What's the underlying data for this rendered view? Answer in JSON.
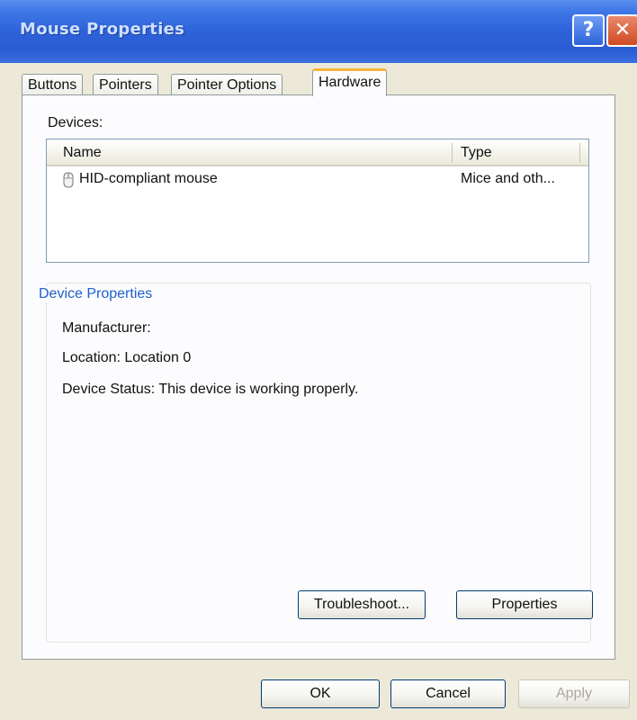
{
  "window": {
    "title": "Mouse Properties",
    "help_glyph": "?",
    "close_glyph": "✕"
  },
  "tabs": [
    {
      "label": "Buttons",
      "active": false
    },
    {
      "label": "Pointers",
      "active": false
    },
    {
      "label": "Pointer Options",
      "active": false
    },
    {
      "label": "Hardware",
      "active": true
    }
  ],
  "hardware": {
    "devices_label": "Devices:",
    "columns": {
      "name": "Name",
      "type": "Type"
    },
    "rows": [
      {
        "icon": "mouse-icon",
        "name": "HID-compliant mouse",
        "type": "Mice and oth..."
      }
    ],
    "device_properties": {
      "title": "Device Properties",
      "manufacturer": "Manufacturer:",
      "location": "Location: Location 0",
      "status": "Device Status: This device is working properly."
    },
    "buttons": {
      "troubleshoot": "Troubleshoot...",
      "properties": "Properties"
    }
  },
  "footer": {
    "ok": "OK",
    "cancel": "Cancel",
    "apply": "Apply"
  },
  "colors": {
    "titlebar": "#2b5bd2",
    "active_tab_accent": "#f3b33c",
    "group_title": "#1f5fcc",
    "disabled_text": "#aca899"
  }
}
